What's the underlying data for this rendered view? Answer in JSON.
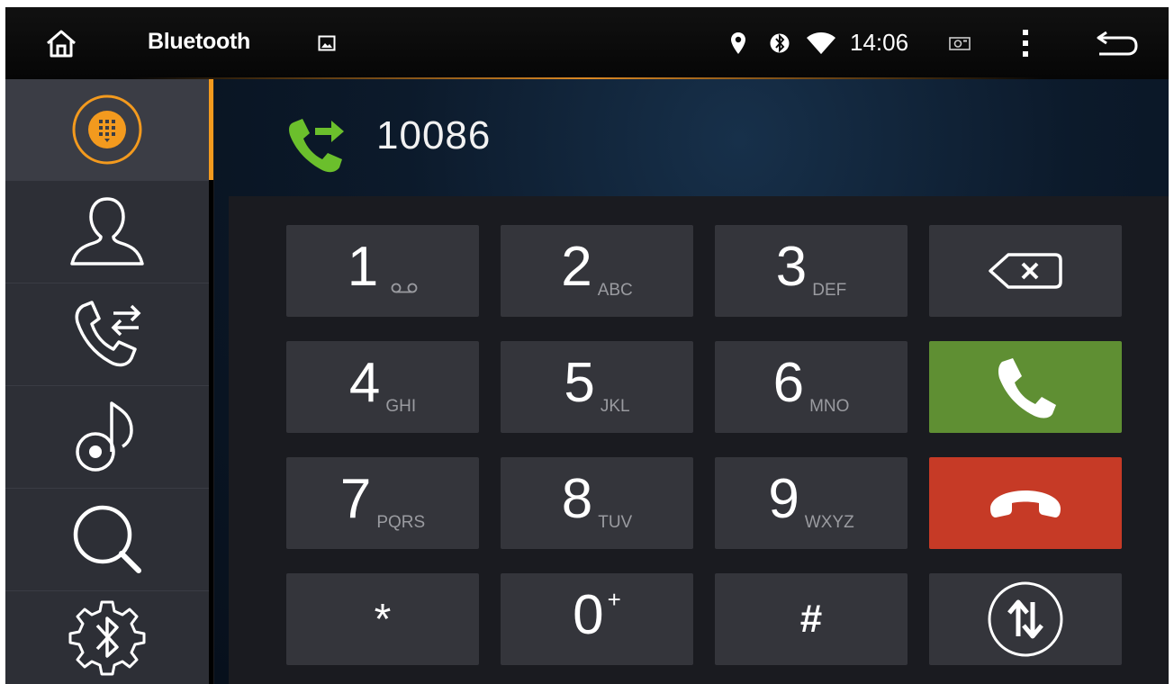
{
  "status_bar": {
    "title": "Bluetooth",
    "time": "14:06",
    "icons": [
      "home-icon",
      "image-icon",
      "location-icon",
      "bluetooth-icon",
      "wifi-icon",
      "screenshot-icon",
      "more-icon",
      "back-icon"
    ]
  },
  "sidebar": {
    "items": [
      {
        "name": "dialpad",
        "icon": "dialpad-icon",
        "active": true
      },
      {
        "name": "contacts",
        "icon": "contact-icon",
        "active": false
      },
      {
        "name": "call-log",
        "icon": "call-log-icon",
        "active": false
      },
      {
        "name": "music",
        "icon": "music-icon",
        "active": false
      },
      {
        "name": "search",
        "icon": "search-icon",
        "active": false
      },
      {
        "name": "bluetooth-settings",
        "icon": "bluetooth-settings-icon",
        "active": false
      }
    ]
  },
  "call": {
    "number": "10086",
    "icon": "call-transfer-icon"
  },
  "keypad": {
    "keys": [
      {
        "digit": "1",
        "letters": ""
      },
      {
        "digit": "2",
        "letters": "ABC"
      },
      {
        "digit": "3",
        "letters": "DEF"
      },
      {
        "digit": "4",
        "letters": "GHI"
      },
      {
        "digit": "5",
        "letters": "JKL"
      },
      {
        "digit": "6",
        "letters": "MNO"
      },
      {
        "digit": "7",
        "letters": "PQRS"
      },
      {
        "digit": "8",
        "letters": "TUV"
      },
      {
        "digit": "9",
        "letters": "WXYZ"
      },
      {
        "digit": "*",
        "letters": ""
      },
      {
        "digit": "0",
        "letters": "+"
      },
      {
        "digit": "#",
        "letters": ""
      }
    ],
    "actions": [
      "backspace-icon",
      "call-icon",
      "hangup-icon",
      "switch-audio-icon"
    ]
  },
  "colors": {
    "accent": "#f39a1e",
    "call_green": "#5f8f33",
    "hangup_red": "#c63a26",
    "key_bg": "#34353b",
    "sidebar_bg": "#2d2f36"
  }
}
